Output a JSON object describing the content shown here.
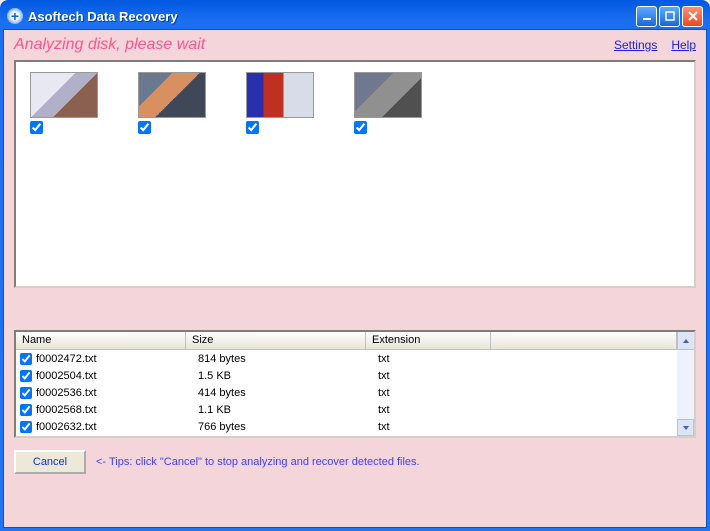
{
  "window": {
    "title": "Asoftech Data Recovery"
  },
  "status": "Analyzing disk, please wait",
  "links": {
    "settings": "Settings",
    "help": "Help"
  },
  "thumbnails": [
    {
      "checked": true
    },
    {
      "checked": true
    },
    {
      "checked": true
    },
    {
      "checked": true
    }
  ],
  "columns": {
    "name": "Name",
    "size": "Size",
    "ext": "Extension"
  },
  "files": [
    {
      "checked": true,
      "name": "f0002472.txt",
      "size": "814 bytes",
      "ext": "txt"
    },
    {
      "checked": true,
      "name": "f0002504.txt",
      "size": "1.5 KB",
      "ext": "txt"
    },
    {
      "checked": true,
      "name": "f0002536.txt",
      "size": "414 bytes",
      "ext": "txt"
    },
    {
      "checked": true,
      "name": "f0002568.txt",
      "size": "1.1 KB",
      "ext": "txt"
    },
    {
      "checked": true,
      "name": "f0002632.txt",
      "size": "766 bytes",
      "ext": "txt"
    }
  ],
  "actions": {
    "cancel": "Cancel"
  },
  "tips": "<- Tips: click \"Cancel\" to stop analyzing and recover detected files."
}
